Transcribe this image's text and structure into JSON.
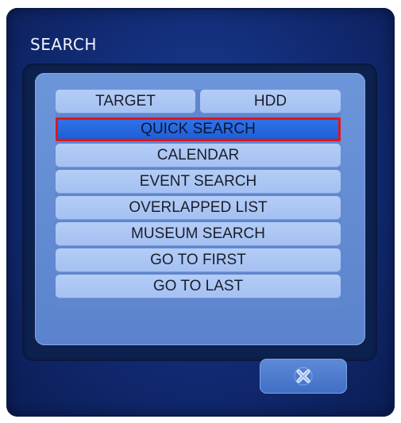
{
  "dialog": {
    "title": "SEARCH"
  },
  "tabs": [
    {
      "label": "TARGET"
    },
    {
      "label": "HDD"
    }
  ],
  "menu": {
    "items": [
      {
        "label": "QUICK SEARCH",
        "selected": true
      },
      {
        "label": "CALENDAR",
        "selected": false
      },
      {
        "label": "EVENT SEARCH",
        "selected": false
      },
      {
        "label": "OVERLAPPED LIST",
        "selected": false
      },
      {
        "label": "MUSEUM SEARCH",
        "selected": false
      },
      {
        "label": "GO TO FIRST",
        "selected": false
      },
      {
        "label": "GO TO LAST",
        "selected": false
      }
    ]
  },
  "close_button": {
    "icon": "close-icon"
  },
  "colors": {
    "dialog_bg": "#112a72",
    "panel_bg": "#5f86cf",
    "item_bg": "#a4c0f2",
    "selected_bg": "#1e5fd6",
    "selection_border": "#e3141c"
  }
}
